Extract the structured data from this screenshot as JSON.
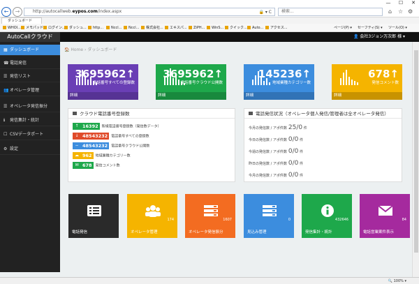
{
  "browser": {
    "window_controls": [
      "—",
      "☐",
      "✕"
    ],
    "address": {
      "prefix": "http://autocallweb.",
      "domain": "eypos.com",
      "suffix": "/index.aspx"
    },
    "address_icons": "🔒 ▾ C",
    "search_placeholder": "検索...",
    "tab_title": "ダッシュボード",
    "favorites": [
      "WHOI...",
      "メモパッド",
      "ログイン...",
      "ダッシュ...",
      "http...",
      "Nccl...",
      "Nccl...",
      "株式会社...",
      "エキスパ...",
      "ZiPH...",
      "WinS...",
      "クイック...",
      "Auto...",
      "アクセス..."
    ],
    "commands": [
      "ページ(P) ▾",
      "セーフティ(S) ▾",
      "ツール(O) ▾"
    ],
    "zoom": "🔍 100% ▾"
  },
  "colors": {
    "purple": "#6a3fb5",
    "green": "#1ea84b",
    "blue": "#3c8dde",
    "yellow": "#f5b400",
    "orange": "#f36c21",
    "magenta": "#a52a9e",
    "dark": "#2a2a2a"
  },
  "header": {
    "brand": "AutoCallクラウド",
    "user": "👤 会社3ジョン万次郎 様 ▾"
  },
  "sidebar": {
    "items": [
      {
        "icon": "▦",
        "label": "ダッシュボード"
      },
      {
        "icon": "☎",
        "label": "電話発信"
      },
      {
        "icon": "☰",
        "label": "発信リスト"
      },
      {
        "icon": "👥",
        "label": "オペレータ管理"
      },
      {
        "icon": "☰",
        "label": "オペレータ発信振分"
      },
      {
        "icon": "ℹ",
        "label": "発信集計・統計"
      },
      {
        "icon": "☐",
        "label": "CSVデータポート"
      },
      {
        "icon": "⚙",
        "label": "設定"
      }
    ]
  },
  "breadcrumb": {
    "home": "🏠 Home",
    "sep": "›",
    "current": "ダッシュボード"
  },
  "stats": [
    {
      "value": "3695962",
      "label": "電話番号すべての登録数",
      "foot": "詳細",
      "arrow": "↑"
    },
    {
      "value": "3695962",
      "label": "電話番号クラウド公開数",
      "foot": "詳細",
      "arrow": "↑"
    },
    {
      "value": "145236",
      "label": "地域業種カテゴリー数",
      "foot": "詳細",
      "arrow": "↑"
    },
    {
      "value": "678",
      "label": "発信コメント数",
      "foot": "詳細",
      "arrow": "↑"
    }
  ],
  "count_panel": {
    "title": "クラウド電話番号登録数",
    "rows": [
      {
        "icon": "↑",
        "badge": "16392",
        "label": "新規電話番号登録数（発信数データ）"
      },
      {
        "icon": "↓",
        "badge": "48543232",
        "label": "電話番号すべての登録数"
      },
      {
        "icon": "−",
        "badge": "48543232",
        "label": "電話番号クラウド公開数"
      },
      {
        "icon": "☁",
        "badge": "962",
        "label": "地域業種カテゴリー数"
      },
      {
        "icon": "✉",
        "badge": "678",
        "label": "発信コメント数"
      }
    ]
  },
  "op_panel": {
    "title": "電話発信状況（オペレータ個人発信/管理者は全オペレータ発信）",
    "rows": [
      {
        "label": "今月の発信数 / アポ件数",
        "value": "25/0",
        "unit": "件"
      },
      {
        "label": "今日の発信数 / アポ件数",
        "value": "0/0",
        "unit": "件"
      },
      {
        "label": "今週の発信数 / アポ件数",
        "value": "0/0",
        "unit": "件"
      },
      {
        "label": "昨日の発信数 / アポ件数",
        "value": "0/0",
        "unit": "件"
      },
      {
        "label": "今月の発信数 / アポ件数",
        "value": "0/0",
        "unit": "件"
      }
    ]
  },
  "tiles": [
    {
      "label": "電話発信",
      "num": "",
      "icon": "phone-list-icon"
    },
    {
      "label": "オペレータ管理",
      "num": "174",
      "icon": "users-icon"
    },
    {
      "label": "オペレータ発信振分",
      "num": "1607",
      "icon": "server-icon"
    },
    {
      "label": "見込み管理",
      "num": "0",
      "icon": "server-icon"
    },
    {
      "label": "発信集計・統計",
      "num": "432646",
      "icon": "info-icon"
    },
    {
      "label": "電話営業案件表示",
      "num": "84",
      "icon": "mail-icon"
    }
  ]
}
